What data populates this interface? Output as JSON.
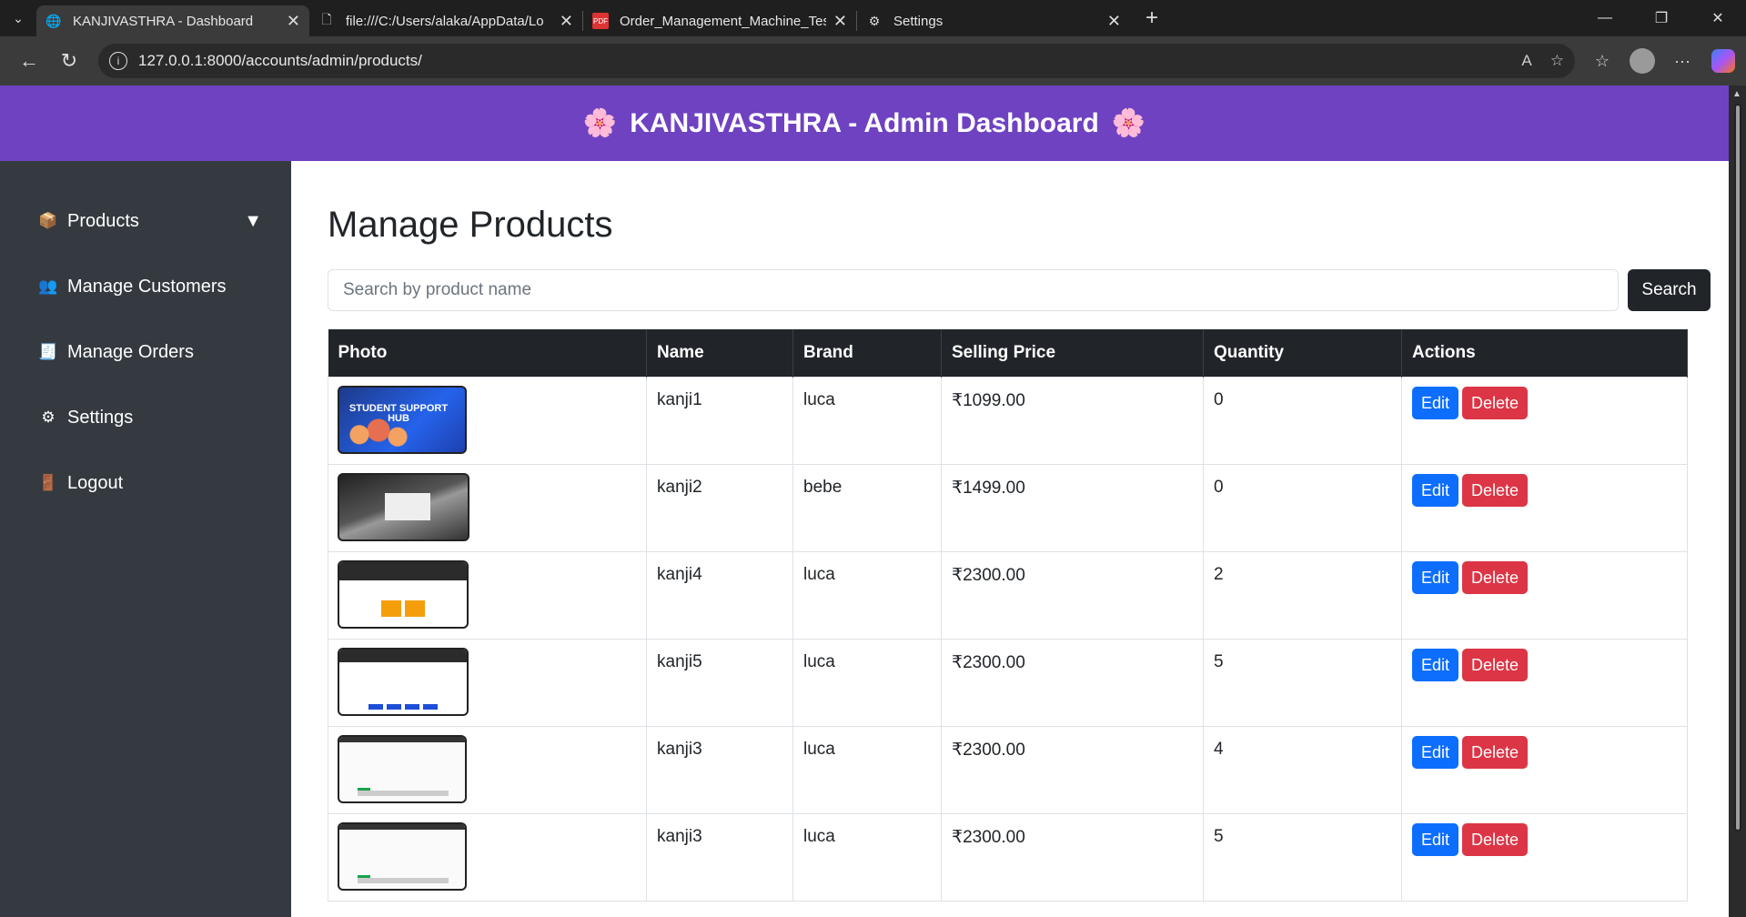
{
  "browser": {
    "tabs": [
      {
        "label": "KANJIVASTHRA - Dashboard",
        "icon": "globe-icon"
      },
      {
        "label": "file:///C:/Users/alaka/AppData/Lo",
        "icon": "file-icon"
      },
      {
        "label": "Order_Management_Machine_Tes",
        "icon": "pdf-icon"
      },
      {
        "label": "Settings",
        "icon": "gear-icon"
      }
    ],
    "url": "127.0.0.1:8000/accounts/admin/products/"
  },
  "header": {
    "title": "KANJIVASTHRA - Admin Dashboard",
    "flower_left": "🌸",
    "flower_right": "🌸",
    "color": "#6f42c1"
  },
  "sidebar": {
    "items": [
      {
        "label": "Products",
        "icon": "📦"
      },
      {
        "label": "Manage Customers",
        "icon": "👥"
      },
      {
        "label": "Manage Orders",
        "icon": "🧾"
      },
      {
        "label": "Settings",
        "icon": "⚙"
      },
      {
        "label": "Logout",
        "icon": "🚪"
      }
    ],
    "caret": "▼"
  },
  "main": {
    "title": "Manage Products",
    "search_placeholder": "Search by product name",
    "search_button": "Search",
    "columns": [
      "Photo",
      "Name",
      "Brand",
      "Selling Price",
      "Quantity",
      "Actions"
    ],
    "rows": [
      {
        "name": "kanji1",
        "brand": "luca",
        "price": "₹1099.00",
        "quantity": "0"
      },
      {
        "name": "kanji2",
        "brand": "bebe",
        "price": "₹1499.00",
        "quantity": "0"
      },
      {
        "name": "kanji4",
        "brand": "luca",
        "price": "₹2300.00",
        "quantity": "2"
      },
      {
        "name": "kanji5",
        "brand": "luca",
        "price": "₹2300.00",
        "quantity": "5"
      },
      {
        "name": "kanji3",
        "brand": "luca",
        "price": "₹2300.00",
        "quantity": "4"
      },
      {
        "name": "kanji3",
        "brand": "luca",
        "price": "₹2300.00",
        "quantity": "5"
      }
    ],
    "edit_label": "Edit",
    "delete_label": "Delete",
    "thumb1_text": "STUDENT SUPPORT HUB"
  }
}
